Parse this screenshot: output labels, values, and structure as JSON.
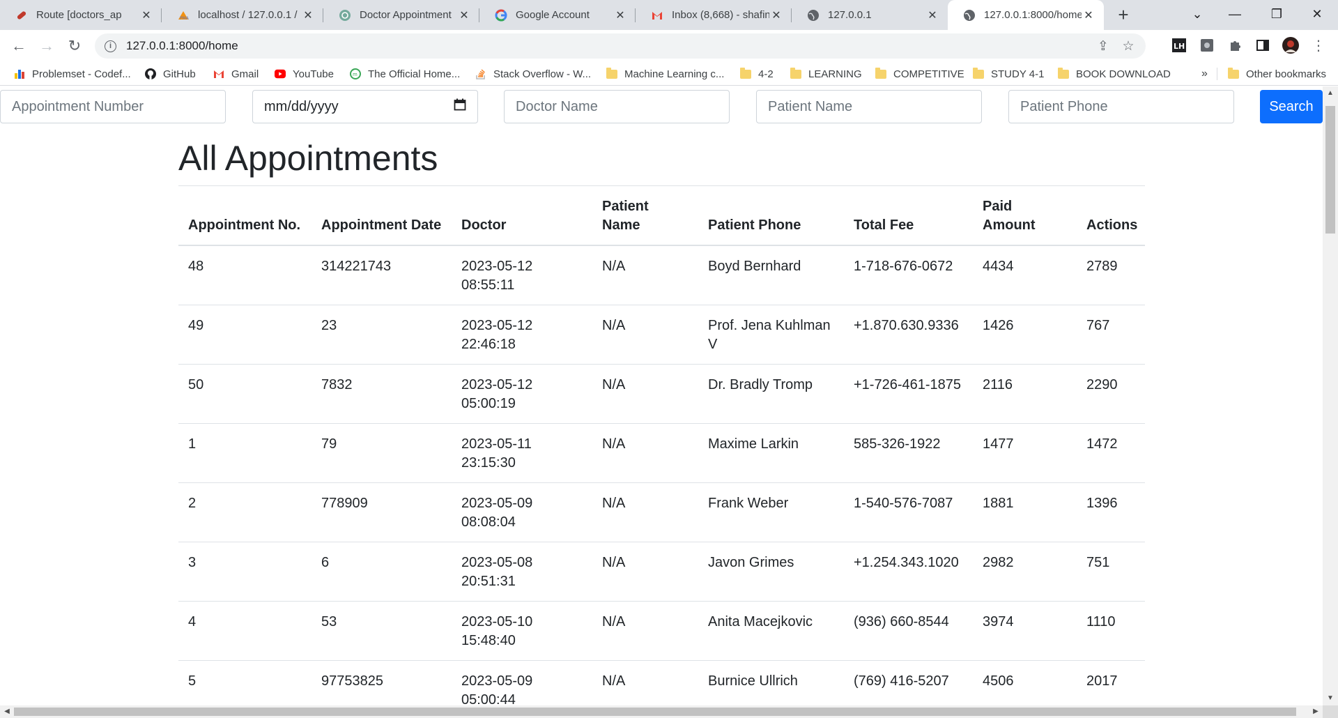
{
  "browser": {
    "tabs": [
      {
        "label": "Route [doctors_ap",
        "icon": "route-icon",
        "active": false
      },
      {
        "label": "localhost / 127.0.0.1 /",
        "icon": "phpmyadmin-icon",
        "active": false
      },
      {
        "label": "Doctor Appointment",
        "icon": "chatgpt-icon",
        "active": false
      },
      {
        "label": "Google Account",
        "icon": "google-icon",
        "active": false
      },
      {
        "label": "Inbox (8,668) - shafin",
        "icon": "gmail-icon",
        "active": false
      },
      {
        "label": "127.0.0.1",
        "icon": "globe-icon",
        "active": false
      },
      {
        "label": "127.0.0.1:8000/home",
        "icon": "globe-icon",
        "active": true
      }
    ],
    "url": "127.0.0.1:8000/home",
    "bookmarks": [
      {
        "label": "Problemset - Codef...",
        "icon": "codeforces-icon"
      },
      {
        "label": "GitHub",
        "icon": "github-icon"
      },
      {
        "label": "Gmail",
        "icon": "gmail-icon"
      },
      {
        "label": "YouTube",
        "icon": "youtube-icon"
      },
      {
        "label": "The Official Home...",
        "icon": "website-icon"
      },
      {
        "label": "Stack Overflow - W...",
        "icon": "stackoverflow-icon"
      },
      {
        "label": "Machine Learning c...",
        "icon": "folder-icon"
      },
      {
        "label": "4-2",
        "icon": "folder-icon"
      },
      {
        "label": "LEARNING",
        "icon": "folder-icon"
      },
      {
        "label": "COMPETITIVE",
        "icon": "folder-icon"
      },
      {
        "label": "STUDY 4-1",
        "icon": "folder-icon"
      },
      {
        "label": "BOOK DOWNLOAD",
        "icon": "folder-icon"
      }
    ],
    "bookmarks_overflow": "»",
    "other_bookmarks": "Other bookmarks"
  },
  "search": {
    "appointment_number_placeholder": "Appointment Number",
    "date_placeholder": "mm/dd/yyyy",
    "doctor_name_placeholder": "Doctor Name",
    "patient_name_placeholder": "Patient Name",
    "patient_phone_placeholder": "Patient Phone",
    "button_label": "Search"
  },
  "page": {
    "title": "All Appointments"
  },
  "table": {
    "headers": [
      "Appointment No.",
      "Appointment Date",
      "Doctor",
      "Patient Name",
      "Patient Phone",
      "Total Fee",
      "Paid Amount",
      "Actions"
    ],
    "rows": [
      [
        "48",
        "314221743",
        "2023-05-12 08:55:11",
        "N/A",
        "Boyd Bernhard",
        "1-718-676-0672",
        "4434",
        "2789"
      ],
      [
        "49",
        "23",
        "2023-05-12 22:46:18",
        "N/A",
        "Prof. Jena Kuhlman V",
        "+1.870.630.9336",
        "1426",
        "767"
      ],
      [
        "50",
        "7832",
        "2023-05-12 05:00:19",
        "N/A",
        "Dr. Bradly Tromp",
        "+1-726-461-1875",
        "2116",
        "2290"
      ],
      [
        "1",
        "79",
        "2023-05-11 23:15:30",
        "N/A",
        "Maxime Larkin",
        "585-326-1922",
        "1477",
        "1472"
      ],
      [
        "2",
        "778909",
        "2023-05-09 08:08:04",
        "N/A",
        "Frank Weber",
        "1-540-576-7087",
        "1881",
        "1396"
      ],
      [
        "3",
        "6",
        "2023-05-08 20:51:31",
        "N/A",
        "Javon Grimes",
        "+1.254.343.1020",
        "2982",
        "751"
      ],
      [
        "4",
        "53",
        "2023-05-10 15:48:40",
        "N/A",
        "Anita Macejkovic",
        "(936) 660-8544",
        "3974",
        "1110"
      ],
      [
        "5",
        "97753825",
        "2023-05-09 05:00:44",
        "N/A",
        "Burnice Ullrich",
        "(769) 416-5207",
        "4506",
        "2017"
      ]
    ]
  },
  "colors": {
    "primary": "#0d6efd",
    "tabstrip": "#dee1e6",
    "border": "#dee2e6"
  }
}
